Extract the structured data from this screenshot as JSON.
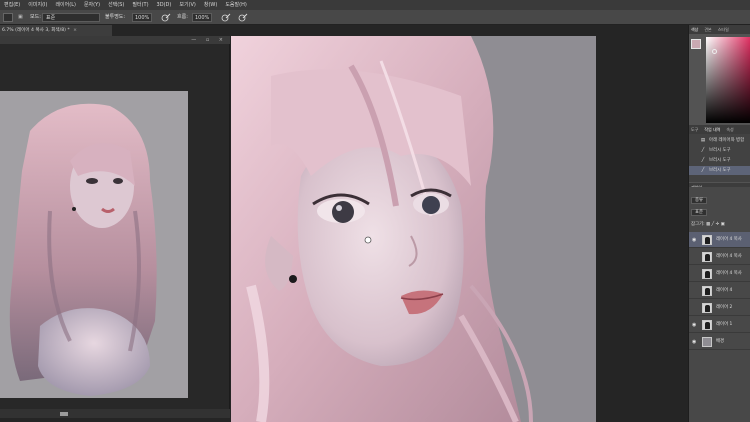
{
  "menu": [
    "편집(E)",
    "이미지(I)",
    "레이어(L)",
    "문자(Y)",
    "선택(S)",
    "필터(T)",
    "3D(D)",
    "보기(V)",
    "창(W)",
    "도움말(H)"
  ],
  "options": {
    "mode_label": "모드:",
    "mode_value": "표준",
    "opacity_label": "불투명도:",
    "opacity_value": "100%",
    "flow_label": "흐름:",
    "flow_value": "100%"
  },
  "document": {
    "tab_title": "6.7% (레이어 4 복사 3, 회색/8) *",
    "tab_close": "×",
    "subwin_title": "",
    "subwin_buttons": "— ▫ ×"
  },
  "panels": {
    "color_tabs": [
      "색상",
      "견본",
      "스타일"
    ],
    "history_tabs": [
      "도구",
      "작업 내역",
      "속성"
    ],
    "history_items": [
      {
        "icon": "document-icon",
        "glyph": "▤",
        "label": "아래 레이어와 병합"
      },
      {
        "icon": "brush-icon",
        "glyph": "╱",
        "label": "브러시 도구"
      },
      {
        "icon": "brush-icon",
        "glyph": "╱",
        "label": "브러시 도구"
      },
      {
        "icon": "brush-icon",
        "glyph": "╱",
        "label": "브러시 도구"
      }
    ],
    "layers_tab": "레이어",
    "kind_value": "종류",
    "blend_value": "표준",
    "lock_label": "잠그기:",
    "layers": [
      {
        "label": "레이어 4 복사",
        "visible": true,
        "selected": true
      },
      {
        "label": "레이어 4 복사",
        "visible": false,
        "selected": false
      },
      {
        "label": "레이어 4 복사",
        "visible": false,
        "selected": false
      },
      {
        "label": "레이어 4",
        "visible": false,
        "selected": false
      },
      {
        "label": "레이어 2",
        "visible": false,
        "selected": false
      },
      {
        "label": "레이어 1",
        "visible": true,
        "selected": false
      },
      {
        "label": "배경",
        "visible": true,
        "selected": false
      }
    ]
  },
  "colors": {
    "foreground": "#caa9b2",
    "background": "#ffffff",
    "canvas_gray": "#8f8d93",
    "hair_pink": "#d9b2be"
  }
}
